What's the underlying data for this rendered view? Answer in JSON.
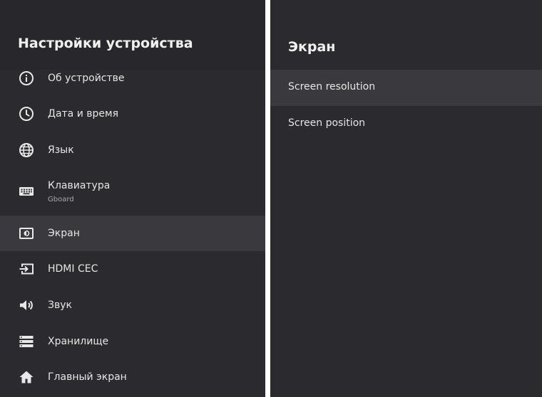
{
  "left_panel": {
    "title": "Настройки устройства",
    "items": [
      {
        "label": "Об устройстве",
        "icon": "info-icon"
      },
      {
        "label": "Дата и время",
        "icon": "clock-icon"
      },
      {
        "label": "Язык",
        "icon": "globe-icon"
      },
      {
        "label": "Клавиатура",
        "sublabel": "Gboard",
        "icon": "keyboard-icon"
      },
      {
        "label": "Экран",
        "icon": "display-icon",
        "selected": true
      },
      {
        "label": "HDMI CEC",
        "icon": "input-icon"
      },
      {
        "label": "Звук",
        "icon": "speaker-icon"
      },
      {
        "label": "Хранилище",
        "icon": "storage-icon"
      },
      {
        "label": "Главный экран",
        "icon": "home-icon"
      }
    ]
  },
  "right_panel": {
    "title": "Экран",
    "items": [
      {
        "label": "Screen resolution",
        "selected": true
      },
      {
        "label": "Screen position"
      }
    ]
  },
  "colors": {
    "panel_bg": "#2b2a2e",
    "header_bg": "#28272b",
    "selected_bg": "#3a393e",
    "text": "#e6e6e6",
    "divider": "#ffffff"
  }
}
